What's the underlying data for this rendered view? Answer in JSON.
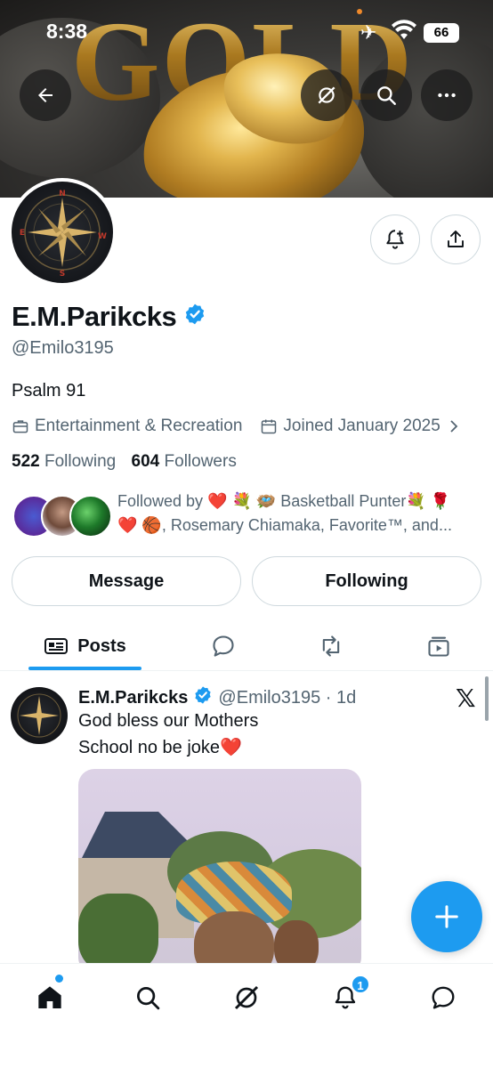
{
  "status_bar": {
    "time": "8:38",
    "battery": "66"
  },
  "banner": {
    "image_text": "GOLD"
  },
  "profile": {
    "name": "E.M.Parikcks",
    "handle": "@Emilo3195",
    "bio": "Psalm 91",
    "category": "Entertainment & Recreation",
    "joined": "Joined January 2025",
    "following_count": "522",
    "following_label": "Following",
    "followers_count": "604",
    "followers_label": "Followers",
    "followed_by_line1": "Followed by ❤️ 💐 🪺 Basketball Punter💐 🌹",
    "followed_by_line2": "❤️ 🏀, Rosemary Chiamaka, Favorite™, and..."
  },
  "actions": {
    "message_label": "Message",
    "following_label": "Following"
  },
  "tabs": {
    "posts_label": "Posts"
  },
  "post": {
    "name": "E.M.Parikcks",
    "handle_time": "@Emilo3195 · 1d",
    "line1": "God bless our Mothers",
    "line2": "School no be joke❤️"
  },
  "notifications": {
    "badge": "1"
  },
  "colors": {
    "accent": "#1d9bf0",
    "text": "#0f1419",
    "muted": "#536471",
    "border": "#cfd9de"
  },
  "icons": [
    "back-arrow-icon",
    "grok-icon",
    "search-icon",
    "more-icon",
    "bell-plus-icon",
    "share-icon",
    "verified-icon",
    "briefcase-icon",
    "calendar-icon",
    "chevron-right-icon",
    "posts-icon",
    "reply-icon",
    "retweet-icon",
    "media-icon",
    "x-logo-icon",
    "plus-icon",
    "home-icon",
    "notifications-icon",
    "messages-icon"
  ]
}
